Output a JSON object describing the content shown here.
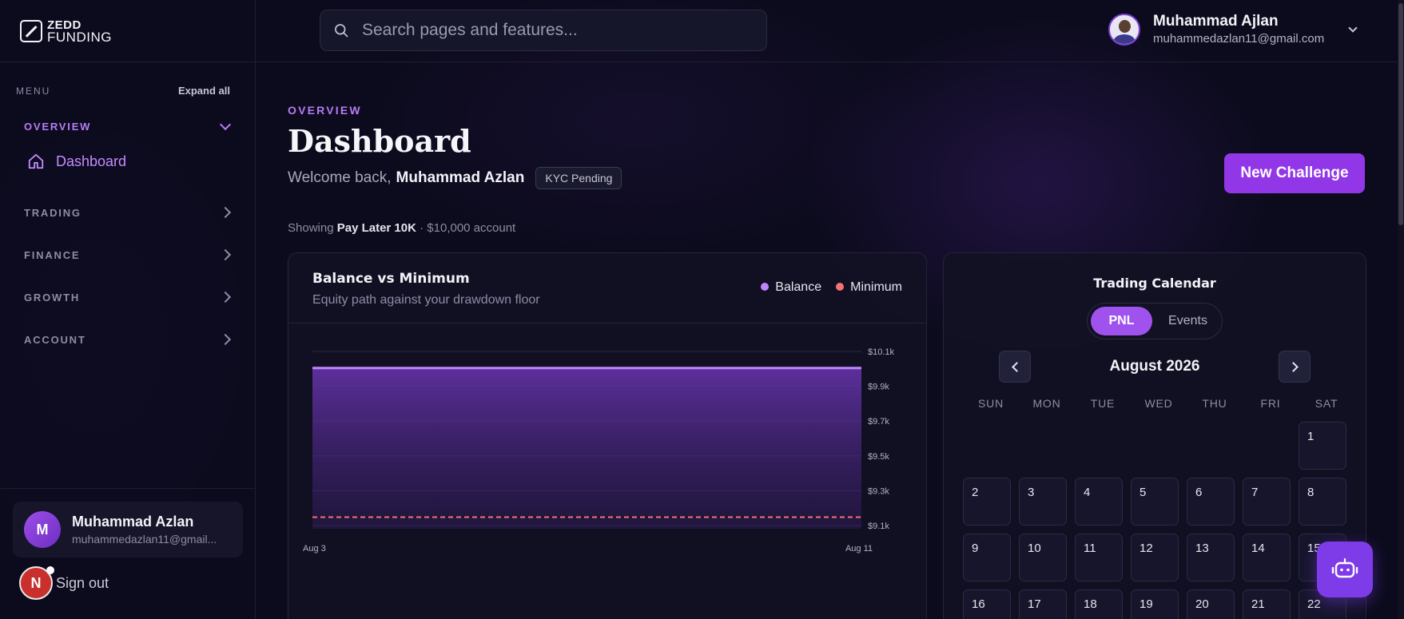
{
  "brand": {
    "line1": "ZEDD",
    "line2": "FUNDING"
  },
  "sidebar": {
    "menu_label": "MENU",
    "expand_label": "Expand all",
    "sections": [
      {
        "label": "OVERVIEW",
        "active": true
      },
      {
        "label": "TRADING"
      },
      {
        "label": "FINANCE"
      },
      {
        "label": "GROWTH"
      },
      {
        "label": "ACCOUNT"
      }
    ],
    "overview_items": [
      {
        "label": "Dashboard",
        "icon": "home-icon"
      }
    ],
    "user": {
      "initial": "M",
      "name": "Muhammad Azlan",
      "email": "muhammedazlan11@gmail..."
    },
    "signout": {
      "badge": "N",
      "label": "Sign out"
    }
  },
  "topbar": {
    "search_placeholder": "Search pages and features...",
    "profile": {
      "name": "Muhammad Ajlan",
      "email": "muhammedazlan11@gmail.com"
    }
  },
  "header": {
    "eyebrow": "OVERVIEW",
    "title": "Dashboard",
    "welcome_prefix": "Welcome back,",
    "welcome_name": "Muhammad Azlan",
    "kyc_badge": "KYC Pending",
    "new_button": "New Challenge",
    "showing_prefix": "Showing",
    "showing_account": "Pay Later 10K",
    "showing_suffix": "· $10,000 account"
  },
  "chart_card": {
    "title": "Balance vs Minimum",
    "subtitle": "Equity path against your drawdown floor",
    "legend": [
      {
        "name": "Balance",
        "color": "#c084fc"
      },
      {
        "name": "Minimum",
        "color": "#f87171"
      }
    ]
  },
  "chart_data": {
    "type": "area",
    "title": "Balance vs Minimum",
    "x": [
      "Aug 3",
      "Aug 11"
    ],
    "series": [
      {
        "name": "Balance",
        "values": [
          10000,
          10000
        ],
        "color": "#c084fc"
      },
      {
        "name": "Minimum",
        "values": [
          9100,
          9100
        ],
        "color": "#f87171",
        "style": "dashed"
      }
    ],
    "yticks": [
      "$10.1k",
      "$9.9k",
      "$9.7k",
      "$9.5k",
      "$9.3k",
      "$9.1k"
    ],
    "ylim": [
      9030,
      10100
    ],
    "grid": true,
    "legend": "top-right"
  },
  "calendar": {
    "title": "Trading Calendar",
    "tabs": [
      {
        "label": "PNL",
        "active": true
      },
      {
        "label": "Events"
      }
    ],
    "month": "August 2026",
    "weekdays": [
      "SUN",
      "MON",
      "TUE",
      "WED",
      "THU",
      "FRI",
      "SAT"
    ],
    "leading_blanks": 6,
    "days": [
      "1",
      "2",
      "3",
      "4",
      "5",
      "6",
      "7",
      "8",
      "9",
      "10",
      "11",
      "12",
      "13",
      "14",
      "15",
      "16",
      "17",
      "18",
      "19",
      "20",
      "21",
      "22"
    ]
  },
  "colors": {
    "accent": "#9237e8",
    "accent_light": "#b67cf5",
    "bg": "#0c0b1d"
  }
}
